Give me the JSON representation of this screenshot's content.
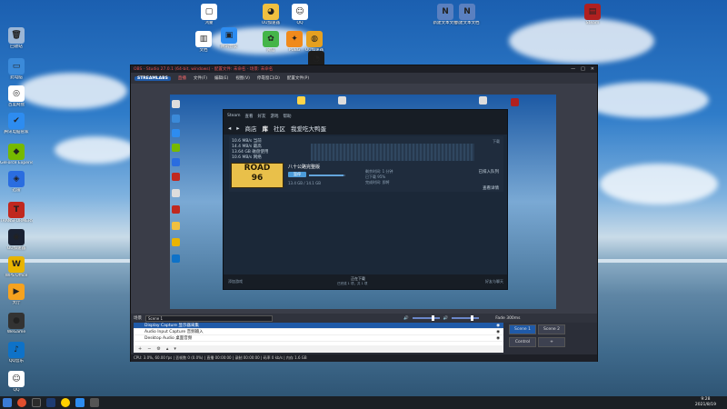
{
  "desktop": {
    "icons_left": [
      {
        "label": "回收站",
        "color": "#9bb6d6",
        "glyph": "🗑"
      },
      {
        "label": "此电脑",
        "color": "#3b8ad9",
        "glyph": "▭"
      },
      {
        "label": "百度网盘",
        "color": "#ffffff",
        "glyph": "◎"
      },
      {
        "label": "腾讯电脑管家",
        "color": "#2d8cf0",
        "glyph": "✔"
      },
      {
        "label": "GeForce Experience",
        "color": "#76b900",
        "glyph": "◆"
      },
      {
        "label": "迅雷",
        "color": "#2a6de0",
        "glyph": "◈"
      },
      {
        "label": "TRANSFORMERS",
        "color": "#c0281f",
        "glyph": "T"
      },
      {
        "label": "UU加速器",
        "color": "#1a2233",
        "glyph": "◉"
      },
      {
        "label": "WPS Office",
        "color": "#e8b400",
        "glyph": "W"
      },
      {
        "label": "大厅",
        "color": "#f5a21f",
        "glyph": "▶"
      },
      {
        "label": "WeGame",
        "color": "#333333",
        "glyph": "●"
      },
      {
        "label": "QQ音乐",
        "color": "#0e72c8",
        "glyph": "♪"
      },
      {
        "label": "QQ",
        "color": "#ffffff",
        "glyph": "☺"
      }
    ],
    "icons_top": [
      {
        "label": "鸿蒙",
        "color": "#ffffff",
        "glyph": "▢"
      },
      {
        "label": "腾讯会议",
        "color": "#2d8cf0",
        "glyph": "▣"
      },
      {
        "label": "UU加速器",
        "color": "#f0c040",
        "glyph": "◕"
      },
      {
        "label": "QQ",
        "color": "#ffffff",
        "glyph": "☺"
      },
      {
        "label": "新建文本文档",
        "color": "#5a80c0",
        "glyph": "N"
      },
      {
        "label": "新建文本文档",
        "color": "#5a80c0",
        "glyph": "N"
      },
      {
        "label": "Steam",
        "color": "#b02020",
        "glyph": "▤"
      },
      {
        "label": "文档",
        "color": "#ffffff",
        "glyph": "▥"
      },
      {
        "label": "UU加速器",
        "color": "#e5a020",
        "glyph": "◍"
      },
      {
        "label": "微信",
        "color": "#44b549",
        "glyph": "✿"
      },
      {
        "label": "PUBG",
        "color": "#f08a1c",
        "glyph": "✦"
      },
      {
        "label": "UU",
        "color": "#1d1d1d",
        "glyph": "◔"
      }
    ]
  },
  "obs": {
    "title": "OBS - Studio 27.0.1 (64-bit, windows) - 配置文件: 未命名 - 场景: 未命名",
    "menu": [
      "文件(F)",
      "编辑(E)",
      "视图(V)",
      "停靠窗口(D)",
      "配置文件(P)",
      "场景集合(S)",
      "工具(T)",
      "帮助(H)"
    ],
    "logo": "STREAMLABS",
    "active_tab": "直播",
    "scene_label": "Scene 1",
    "sources": [
      "Display Capture 显示器采集",
      "Audio Input Capture 音频输入",
      "Desktop Audio 桌面音频",
      "视频采集设备"
    ],
    "buttons": [
      "Scene 1",
      "Scene 2",
      "Control",
      "+"
    ],
    "status": "CPU: 3.0%, 60.00 fps | 丢帧数 0 (0.0%) | 直播 00:00:00 | 录制 00:00:00 | 码率 0 kb/s | 内存 1.6 GB",
    "volume_label": "Fade 300ms"
  },
  "steam": {
    "top": [
      "Steam",
      "查看",
      "好友",
      "游戏",
      "帮助"
    ],
    "nav": [
      "商店",
      "库",
      "社区",
      "我爱吃大鸭蛋"
    ],
    "active_nav": "库",
    "stats": [
      "10.6 MB/s 当前",
      "14.4 MB/s 最高",
      "13.64 GB 磁盘使用",
      "10.6 MB/s 网络"
    ],
    "panel_label": "下载",
    "download": {
      "name": "八十公路完整版",
      "button": "暂停",
      "bar_percent": 95,
      "size": "13.4 GB / 14.1 GB",
      "meta": [
        "剩余时间: 1 分钟",
        "已下载 95%",
        "完成时间: 即将"
      ],
      "right": [
        "已排入队列",
        "查看详情"
      ]
    },
    "footer_left": "添加游戏",
    "footer_center": "正在下载",
    "footer_sub": "已完成 1 项，共 1 项",
    "footer_right": "好友与聊天"
  },
  "taskbar": {
    "time": "9:28",
    "date": "2021/8/19"
  }
}
